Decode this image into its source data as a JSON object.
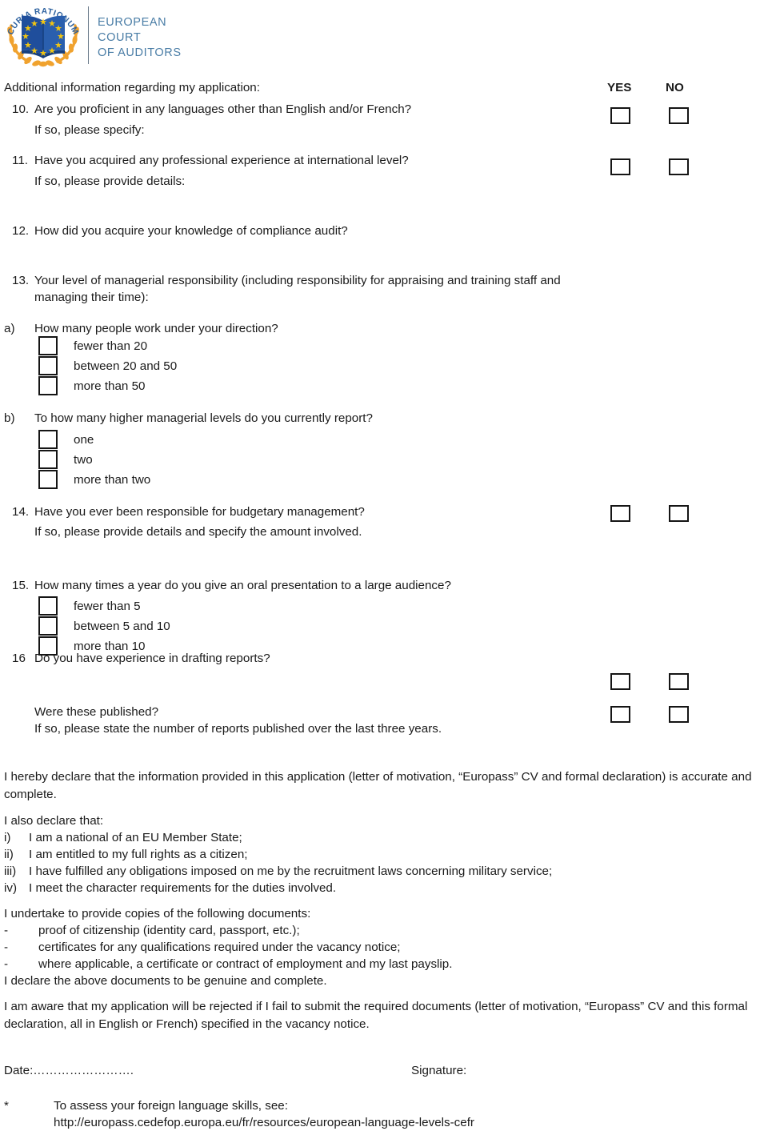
{
  "header": {
    "logo_arc_text": "CURIA RATIONUM",
    "org_line1": "EUROPEAN",
    "org_line2": "COURT",
    "org_line3": "OF AUDITORS",
    "logo_colors": {
      "book_blue": "#1f4e9c",
      "star_yellow": "#f2c511",
      "laurel_orange": "#f0a22e",
      "text_blue": "#4a7da6",
      "arc_text_blue": "#2a5f9e"
    }
  },
  "section": {
    "intro": "Additional information regarding my application:",
    "col_yes": "YES",
    "col_no": "NO"
  },
  "questions": {
    "q10": {
      "number": "10.",
      "text": "Are you proficient in any languages other than English and/or French?",
      "sub": "If so, please specify:"
    },
    "q11": {
      "number": "11.",
      "text": "Have you acquired any professional experience at international level?",
      "sub": "If so, please provide details:"
    },
    "q12": {
      "number": "12.",
      "text": "How did you acquire your knowledge of compliance audit?"
    },
    "q13": {
      "number": "13.",
      "text_line1": "Your level of managerial responsibility (including responsibility for appraising and training staff and",
      "text_line2": "managing their time):"
    },
    "qa": {
      "marker": "a)",
      "text": "How many people work under your direction?",
      "options": [
        "fewer than 20",
        "between 20 and 50",
        "more than 50"
      ]
    },
    "qb": {
      "marker": "b)",
      "text": "To how many higher managerial levels do you currently report?",
      "options": [
        "one",
        "two",
        "more than two"
      ]
    },
    "q14": {
      "number": "14.",
      "text": "Have you ever been responsible for budgetary management?",
      "sub": "If so, please provide details and specify the amount involved."
    },
    "q15": {
      "number": "15.",
      "text": "How many times a year do you give an oral presentation to a large audience?",
      "options": [
        "fewer than 5",
        "between 5 and 10",
        "more than 10"
      ]
    },
    "q16": {
      "number": "16",
      "text": "Do you have experience in drafting reports?",
      "sub1": "Were these published?",
      "sub2": "If so, please state the number of reports published over the last three years."
    }
  },
  "declaration": {
    "para1": "I hereby declare that the information provided in this application (letter of motivation, “Europass” CV and formal declaration) is accurate and complete.",
    "also_header": "I also declare that:",
    "items": [
      {
        "marker": "i)",
        "text": "I am a national of an EU Member State;"
      },
      {
        "marker": "ii)",
        "text": "I am entitled to my full rights as a citizen;"
      },
      {
        "marker": "iii)",
        "text": "I have fulfilled any obligations imposed on me by the recruitment laws concerning military service;"
      },
      {
        "marker": "iv)",
        "text": "I meet the character requirements for the duties involved."
      }
    ],
    "undertake_header": "I undertake to provide copies of the following documents:",
    "documents": [
      {
        "marker": "-",
        "text": "proof of citizenship (identity card, passport, etc.);"
      },
      {
        "marker": "-",
        "text": "certificates for any qualifications required under the vacancy notice;"
      },
      {
        "marker": "-",
        "text": "where applicable, a certificate or contract of employment and my last payslip."
      }
    ],
    "genuine": "I declare the above documents to be genuine and complete.",
    "aware": "I am aware that my application will be rejected if I fail to submit the required documents (letter of motivation, “Europass” CV and this formal declaration, all in English or French) specified in the vacancy notice."
  },
  "signature": {
    "date_label": "Date:…………………….",
    "signature_label": "Signature:"
  },
  "footnote": {
    "marker": "*",
    "line1": "To assess your foreign language skills, see:",
    "line2": "http://europass.cedefop.europa.eu/fr/resources/european-language-levels-cefr"
  }
}
